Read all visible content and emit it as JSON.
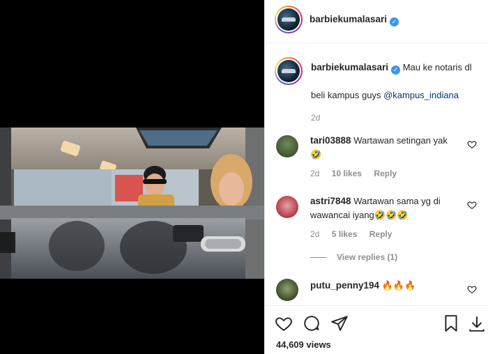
{
  "post": {
    "author": "barbiekumalasari",
    "caption_line1": "Mau ke notaris dl",
    "caption_line2_prefix": "beli kampus guys",
    "caption_mention": "@kampus_indiana",
    "time": "2d"
  },
  "comments": [
    {
      "user": "tari03888",
      "text": "Wartawan setingan yak",
      "text2": "🤣",
      "time": "2d",
      "likes": "10 likes",
      "reply": "Reply"
    },
    {
      "user": "astri7848",
      "text": "Wartawan sama yg di",
      "text2": "wawancai iyang🤣🤣🤣",
      "time": "2d",
      "likes": "5 likes",
      "reply": "Reply"
    },
    {
      "user": "putu_penny194",
      "text": "🔥🔥🔥"
    }
  ],
  "view_replies": "View replies (1)",
  "views": "44,609 views",
  "colors": {
    "accent": "#3897f0",
    "mention": "#00376b",
    "muted": "#8e8e8e"
  },
  "icons": [
    "heart-icon",
    "comment-icon",
    "share-icon",
    "bookmark-icon",
    "download-icon",
    "verified-icon"
  ]
}
